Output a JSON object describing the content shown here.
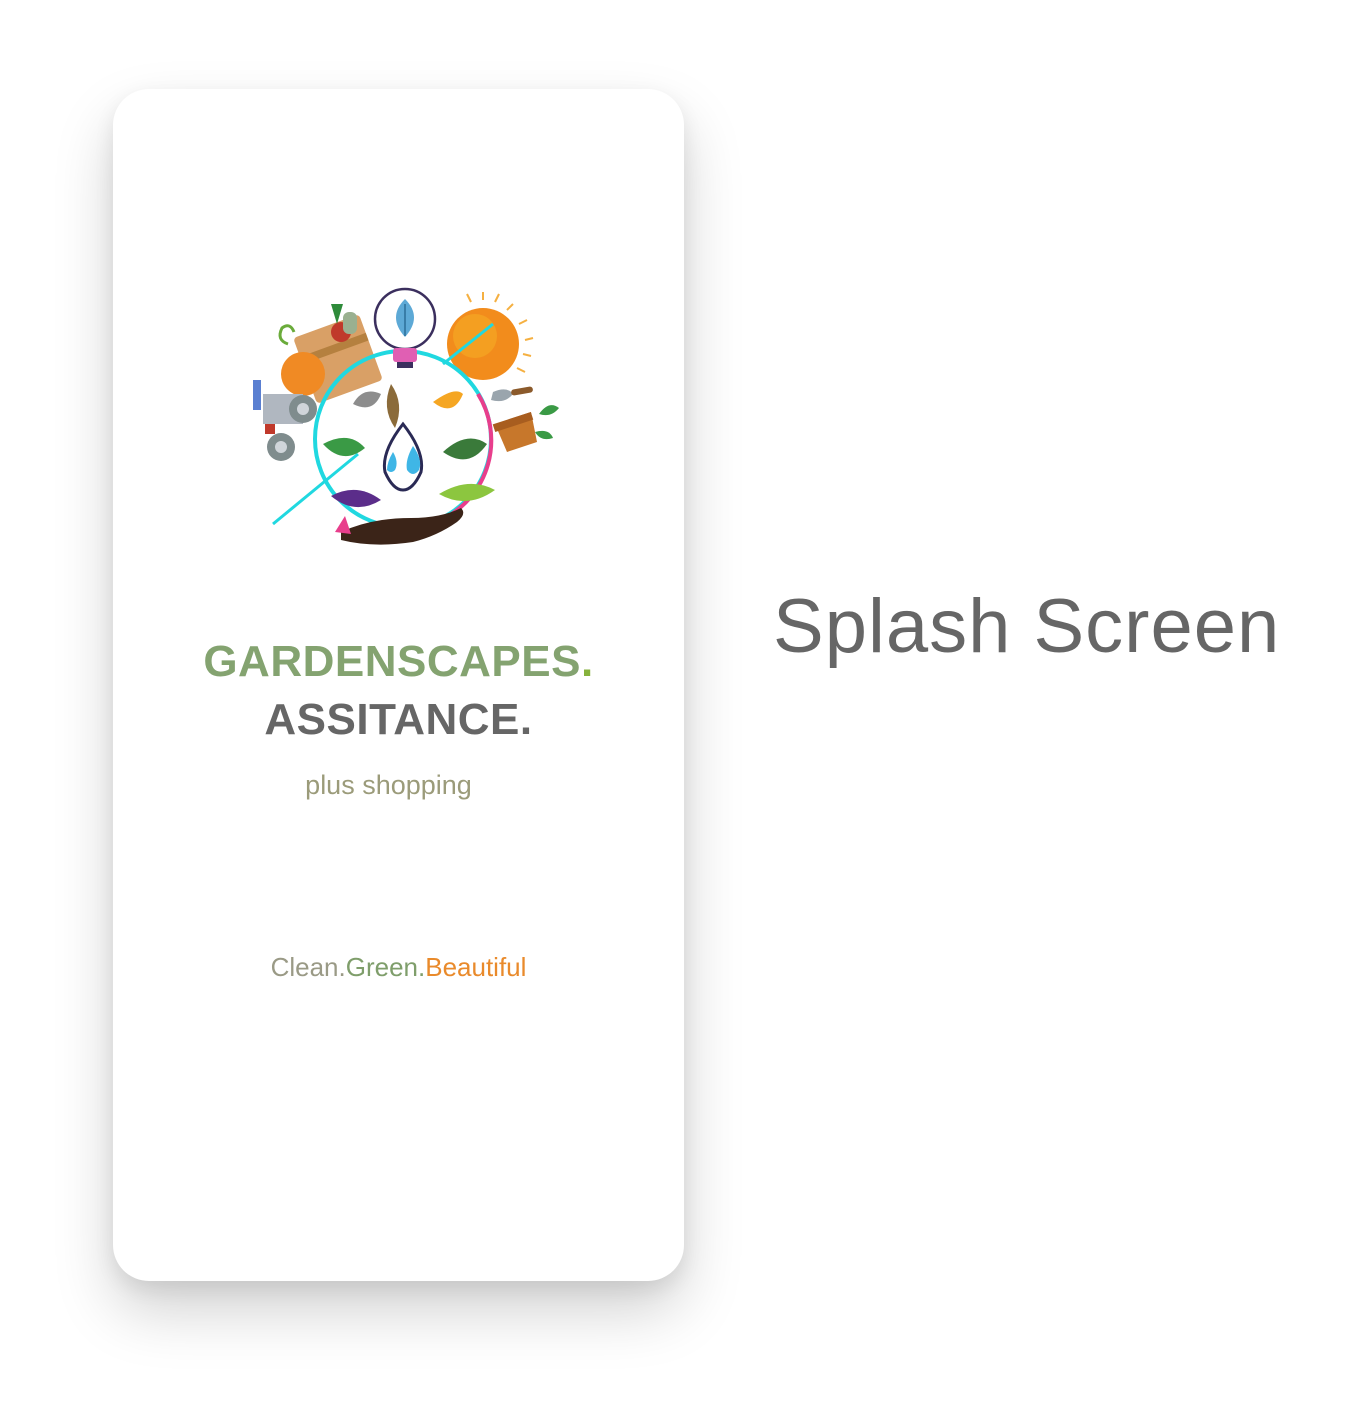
{
  "app": {
    "title_line1": "GARDENSCAPES",
    "title_line1_dot": ".",
    "title_line2": "ASSITANCE.",
    "subtitle": "plus shopping",
    "tagline": {
      "part1": "Clean.",
      "part2": "Green.",
      "part3": "Beautiful"
    }
  },
  "side_label": "Splash Screen",
  "logo": {
    "icon": "garden-emblem-icon"
  },
  "colors": {
    "title_green": "#84a370",
    "title_gray": "#666666",
    "subtitle": "#9b9b7a",
    "tagline_gray": "#9a9a86",
    "tagline_green": "#7f9e6b",
    "tagline_orange": "#e98a2b"
  }
}
